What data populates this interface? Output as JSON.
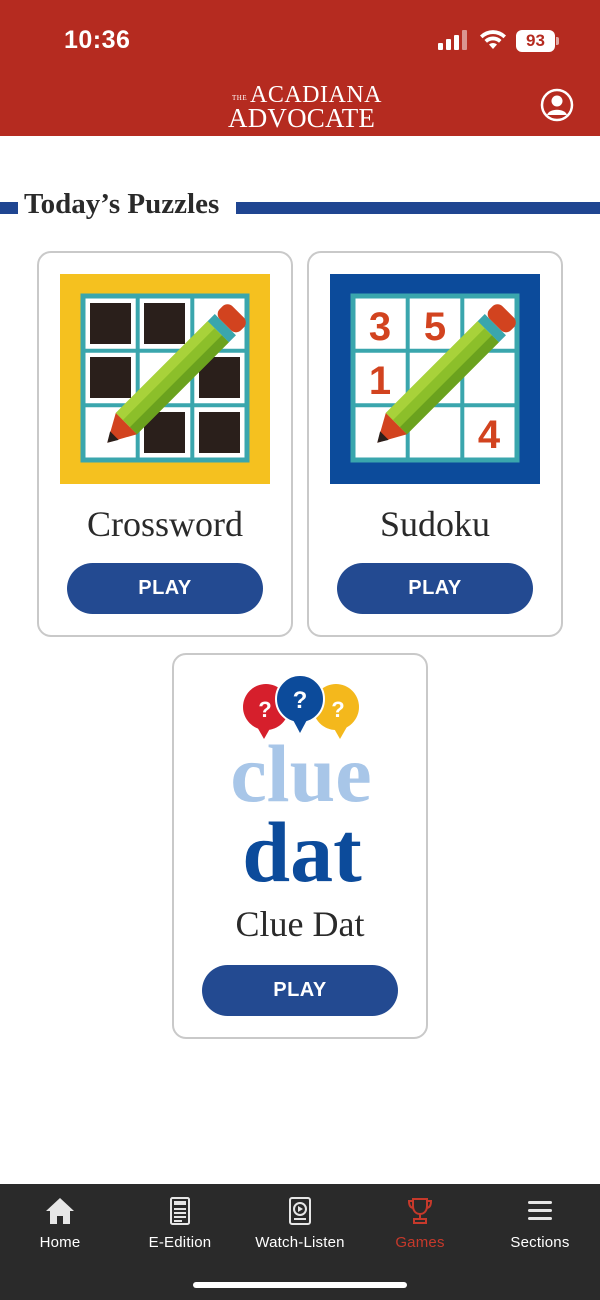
{
  "status_bar": {
    "time": "10:36",
    "battery": "93"
  },
  "header": {
    "logo_the": "THE",
    "logo_line1": "ACADIANA",
    "logo_line2": "ADVOCATE",
    "icons": [
      "signal-icon",
      "wifi-icon",
      "battery-icon",
      "profile-icon"
    ]
  },
  "section": {
    "title": "Today’s Puzzles"
  },
  "puzzles": [
    {
      "name": "Crossword",
      "play_label": "PLAY",
      "icon": "crossword-pencil-icon"
    },
    {
      "name": "Sudoku",
      "play_label": "PLAY",
      "icon": "sudoku-pencil-icon",
      "digits": [
        "3",
        "5",
        "1",
        "4"
      ]
    },
    {
      "name": "Clue Dat",
      "play_label": "PLAY",
      "icon": "clue-dat-logo",
      "logo_text": [
        "clue",
        "dat"
      ],
      "bubble_marks": [
        "?",
        "?",
        "?"
      ]
    }
  ],
  "bottom_nav": {
    "items": [
      {
        "label": "Home",
        "icon": "home-icon",
        "active": false
      },
      {
        "label": "E-Edition",
        "icon": "document-icon",
        "active": false
      },
      {
        "label": "Watch-Listen",
        "icon": "play-video-icon",
        "active": false
      },
      {
        "label": "Games",
        "icon": "trophy-icon",
        "active": true
      },
      {
        "label": "Sections",
        "icon": "menu-icon",
        "active": false
      }
    ]
  },
  "colors": {
    "header_red": "#b52b20",
    "brand_blue": "#234a91",
    "nav_bg": "#2a2a2a",
    "active_red": "#c6392b",
    "crossword_yellow": "#f5c11f",
    "sudoku_blue": "#0c4b9b"
  }
}
